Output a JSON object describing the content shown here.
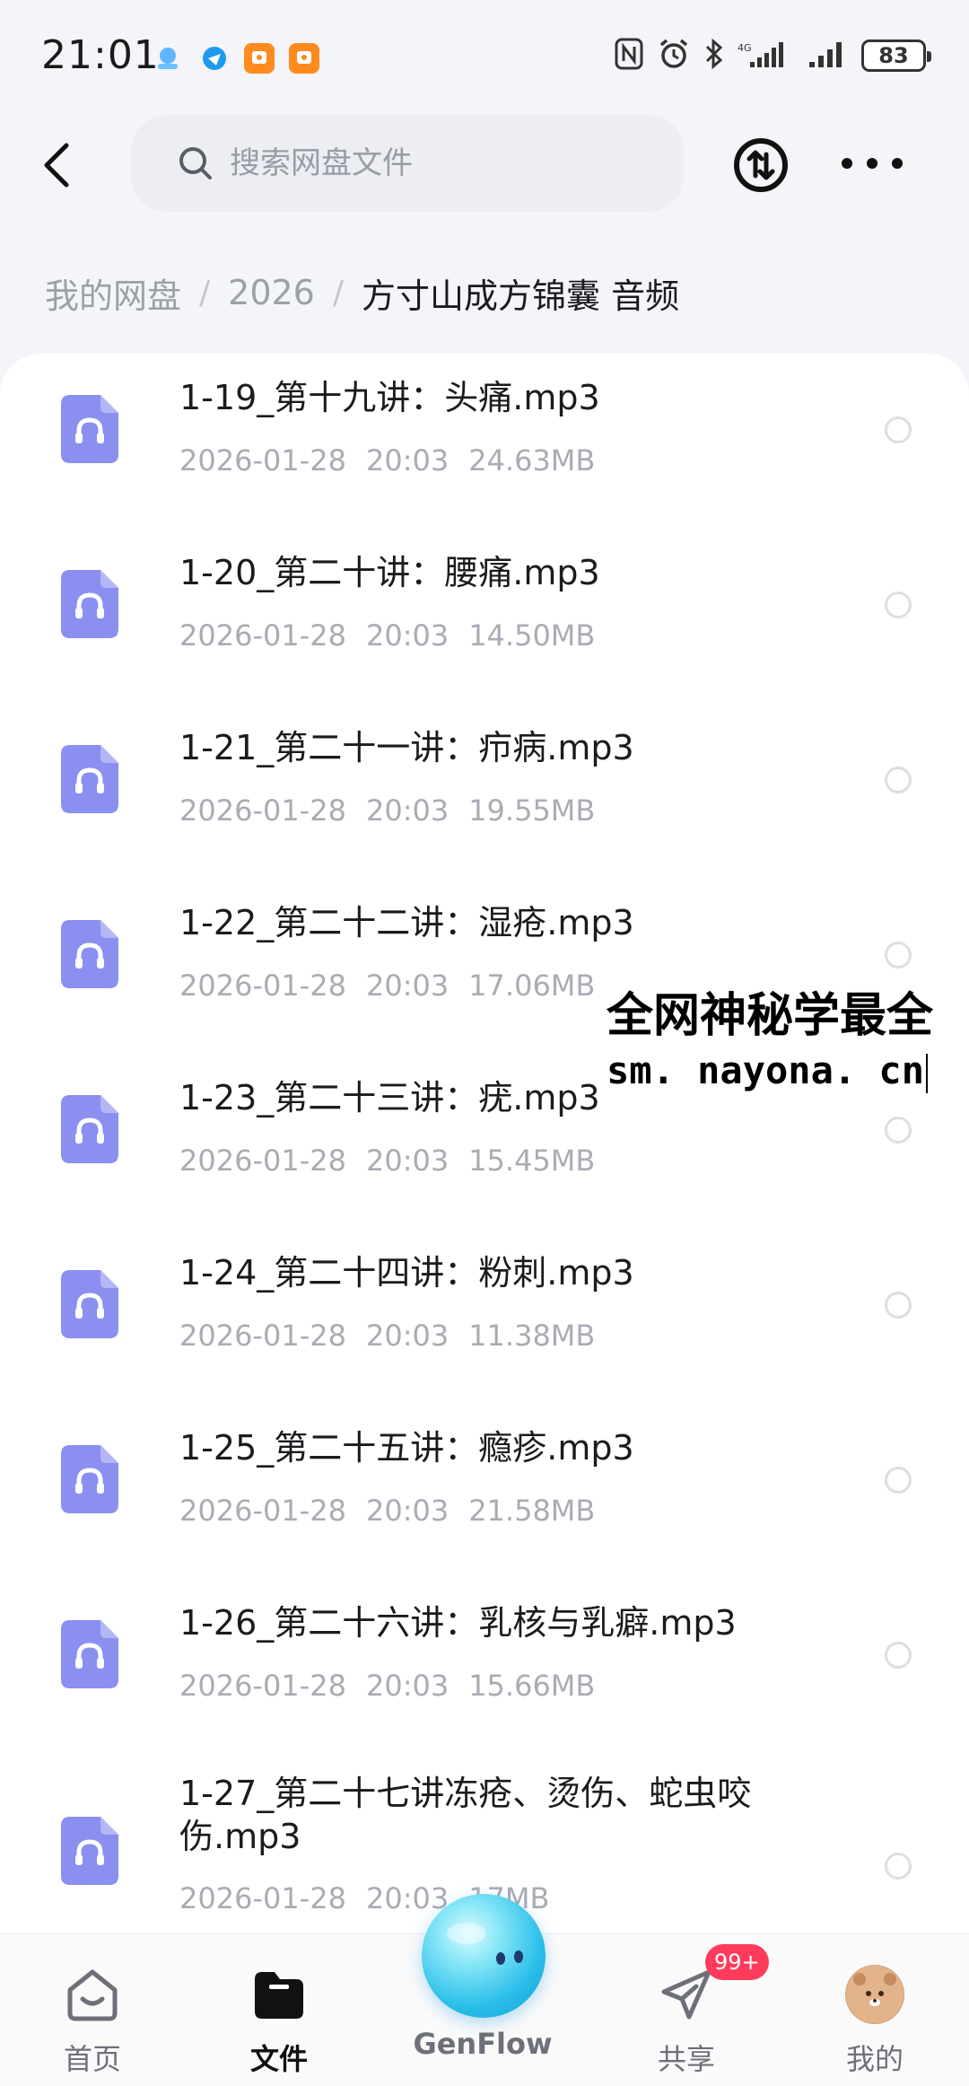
{
  "status_bar": {
    "time": "21:01",
    "battery": "83",
    "notification_icons": [
      "genflow-app-icon",
      "browser-icon",
      "orange-app-icon",
      "orange-app-icon"
    ],
    "system_icons": [
      "nfc-icon",
      "alarm-icon",
      "bluetooth-icon",
      "signal-icon",
      "signal-icon",
      "battery-icon"
    ]
  },
  "header": {
    "search_placeholder": "搜索网盘文件",
    "icons": [
      "back-icon",
      "search-icon",
      "transfer-icon",
      "more-icon"
    ]
  },
  "breadcrumb": {
    "items": [
      "我的网盘",
      "2026"
    ],
    "separator": "/",
    "current": "方寸山成方锦囊 音频"
  },
  "files": [
    {
      "name": "1-19_第十九讲：头痛.mp3",
      "date": "2026-01-28",
      "time": "20:03",
      "size": "24.63MB"
    },
    {
      "name": "1-20_第二十讲：腰痛.mp3",
      "date": "2026-01-28",
      "time": "20:03",
      "size": "14.50MB"
    },
    {
      "name": "1-21_第二十一讲：疖病.mp3",
      "date": "2026-01-28",
      "time": "20:03",
      "size": "19.55MB"
    },
    {
      "name": "1-22_第二十二讲：湿疮.mp3",
      "date": "2026-01-28",
      "time": "20:03",
      "size": "17.06MB"
    },
    {
      "name": "1-23_第二十三讲：疣.mp3",
      "date": "2026-01-28",
      "time": "20:03",
      "size": "15.45MB"
    },
    {
      "name": "1-24_第二十四讲：粉刺.mp3",
      "date": "2026-01-28",
      "time": "20:03",
      "size": "11.38MB"
    },
    {
      "name": "1-25_第二十五讲：瘾疹.mp3",
      "date": "2026-01-28",
      "time": "20:03",
      "size": "21.58MB"
    },
    {
      "name": "1-26_第二十六讲：乳核与乳癖.mp3",
      "date": "2026-01-28",
      "time": "20:03",
      "size": "15.66MB"
    }
  ],
  "last_file": {
    "name_line1": "1-27_第二十七讲冻疮、烫伤、蛇虫咬",
    "name_line2": "伤.mp3",
    "date": "2026-01-28",
    "time": "20:03",
    "size": "17MB"
  },
  "watermark": {
    "line1": "全网神秘学最全",
    "line2": "sm. nayona. cn"
  },
  "bottom_nav": {
    "home": "首页",
    "files": "文件",
    "genflow": "GenFlow",
    "share": "共享",
    "share_badge": "99+",
    "mine": "我的",
    "active": "文件"
  },
  "colors": {
    "file_icon": "#8b8ff0",
    "accent_orb": "#29bde9",
    "badge": "#ff3b5c",
    "meta_text": "#a9acb4"
  }
}
